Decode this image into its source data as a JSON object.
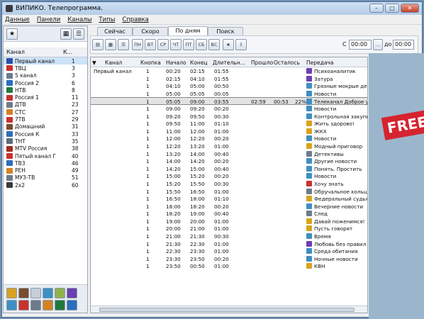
{
  "window": {
    "title": "ВИПИКО. Телепрограмма."
  },
  "menu": [
    "Данные",
    "Панели",
    "Каналы",
    "Типы",
    "Справка"
  ],
  "channels": {
    "header": [
      "Канал",
      "К..."
    ],
    "rows": [
      {
        "name": "Первый канал",
        "num": "1",
        "color": "#2a4fa8",
        "selected": true
      },
      {
        "name": "ТВЦ",
        "num": "3",
        "color": "#c8322e"
      },
      {
        "name": "5 канал",
        "num": "3",
        "color": "#6b7c8e"
      },
      {
        "name": "Россия 2",
        "num": "6",
        "color": "#2b6dbb"
      },
      {
        "name": "НТВ",
        "num": "8",
        "color": "#1f7a3a"
      },
      {
        "name": "Россия 1",
        "num": "11",
        "color": "#c8322e"
      },
      {
        "name": "ДТВ",
        "num": "23",
        "color": "#6d7b8a"
      },
      {
        "name": "СТС",
        "num": "27",
        "color": "#d28322"
      },
      {
        "name": "7ТВ",
        "num": "29",
        "color": "#c8322e"
      },
      {
        "name": "Домашний",
        "num": "31",
        "color": "#7a4d2a"
      },
      {
        "name": "Россия К",
        "num": "33",
        "color": "#2b6dbb"
      },
      {
        "name": "ТНТ",
        "num": "35",
        "color": "#5a6b7d"
      },
      {
        "name": "MTV Россия",
        "num": "38",
        "color": "#a02a1e"
      },
      {
        "name": "Пятый канал Г",
        "num": "40",
        "color": "#c8322e"
      },
      {
        "name": "ТВ3",
        "num": "46",
        "color": "#2b6dbb"
      },
      {
        "name": "РЕН",
        "num": "49",
        "color": "#d28322"
      },
      {
        "name": "МУЗ-ТВ",
        "num": "51",
        "color": "#6d7b8a"
      },
      {
        "name": "2x2",
        "num": "60",
        "color": "#3a3a3a"
      }
    ]
  },
  "tabs": [
    "Сейчас",
    "Скоро",
    "По дням",
    "Поиск"
  ],
  "toolbar": {
    "days": [
      "ПН",
      "ВТ",
      "СР",
      "ЧТ",
      "ПТ",
      "СБ",
      "ВС"
    ],
    "from_label": "С",
    "from_value": "00:00",
    "to_label": "до",
    "to_value": "00:00",
    "more_label": "..."
  },
  "grid": {
    "columns": [
      "Канал",
      "Кнопка",
      "Начало",
      "Конец",
      "Длительн...",
      "Прошло",
      "Осталось",
      "Передача"
    ],
    "channel_label": "Первый канал",
    "rows": [
      {
        "btn": "1",
        "start": "00:20",
        "end": "02:15",
        "dur": "01:55",
        "passed": "",
        "left": "",
        "pct": "",
        "title": "Психоаналитик",
        "color": "#6c3fb0"
      },
      {
        "btn": "1",
        "start": "02:15",
        "end": "04:10",
        "dur": "01:55",
        "passed": "",
        "left": "",
        "pct": "",
        "title": "Затура",
        "color": "#6c3fb0"
      },
      {
        "btn": "1",
        "start": "04:10",
        "end": "05:00",
        "dur": "00:50",
        "passed": "",
        "left": "",
        "pct": "",
        "title": "Грязные мокрые день",
        "color": "#3f8fc4"
      },
      {
        "btn": "1",
        "start": "05:00",
        "end": "05:05",
        "dur": "00:05",
        "passed": "",
        "left": "",
        "pct": "",
        "title": "Новости",
        "color": "#3f8fc4"
      },
      {
        "btn": "1",
        "start": "05:05",
        "end": "09:00",
        "dur": "03:55",
        "passed": "02:59",
        "left": "00:53",
        "pct": "22%",
        "title": "Телеканал Доброе ут",
        "color": "#3f8fc4",
        "selected": true
      },
      {
        "btn": "1",
        "start": "09:00",
        "end": "09:20",
        "dur": "00:20",
        "passed": "",
        "left": "",
        "pct": "",
        "title": "Новости",
        "color": "#3f8fc4"
      },
      {
        "btn": "1",
        "start": "09:20",
        "end": "09:50",
        "dur": "00:30",
        "passed": "",
        "left": "",
        "pct": "",
        "title": "Контрольная закупка",
        "color": "#3f8fc4"
      },
      {
        "btn": "1",
        "start": "09:50",
        "end": "11:00",
        "dur": "01:10",
        "passed": "",
        "left": "",
        "pct": "",
        "title": "Жить здорово!",
        "color": "#d9a21f"
      },
      {
        "btn": "1",
        "start": "11:00",
        "end": "12:00",
        "dur": "01:00",
        "passed": "",
        "left": "",
        "pct": "",
        "title": "ЖКХ",
        "color": "#d9a21f"
      },
      {
        "btn": "1",
        "start": "12:00",
        "end": "12:20",
        "dur": "00:20",
        "passed": "",
        "left": "",
        "pct": "",
        "title": "Новости",
        "color": "#3f8fc4"
      },
      {
        "btn": "1",
        "start": "12:20",
        "end": "13:20",
        "dur": "01:00",
        "passed": "",
        "left": "",
        "pct": "",
        "title": "Модный приговор",
        "color": "#d9a21f"
      },
      {
        "btn": "1",
        "start": "13:20",
        "end": "14:00",
        "dur": "00:40",
        "passed": "",
        "left": "",
        "pct": "",
        "title": "Детективы",
        "color": "#6d7b8a"
      },
      {
        "btn": "1",
        "start": "14:00",
        "end": "14:20",
        "dur": "00:20",
        "passed": "",
        "left": "",
        "pct": "",
        "title": "Другие новости",
        "color": "#3f8fc4"
      },
      {
        "btn": "1",
        "start": "14:20",
        "end": "15:00",
        "dur": "00:40",
        "passed": "",
        "left": "",
        "pct": "",
        "title": "Понять. Простить",
        "color": "#3f8fc4"
      },
      {
        "btn": "1",
        "start": "15:00",
        "end": "15:20",
        "dur": "00:20",
        "passed": "",
        "left": "",
        "pct": "",
        "title": "Новости",
        "color": "#3f8fc4"
      },
      {
        "btn": "1",
        "start": "15:20",
        "end": "15:50",
        "dur": "00:30",
        "passed": "",
        "left": "",
        "pct": "",
        "title": "Хочу знать",
        "color": "#c8322e"
      },
      {
        "btn": "1",
        "start": "15:50",
        "end": "16:50",
        "dur": "01:00",
        "passed": "",
        "left": "",
        "pct": "",
        "title": "Обручальное кольцо",
        "color": "#6d7b8a"
      },
      {
        "btn": "1",
        "start": "16:50",
        "end": "18:00",
        "dur": "01:10",
        "passed": "",
        "left": "",
        "pct": "",
        "title": "Федеральный судья",
        "color": "#d9a21f"
      },
      {
        "btn": "1",
        "start": "18:00",
        "end": "18:20",
        "dur": "00:20",
        "passed": "",
        "left": "",
        "pct": "",
        "title": "Вечерние новости",
        "color": "#3f8fc4"
      },
      {
        "btn": "1",
        "start": "18:20",
        "end": "19:00",
        "dur": "00:40",
        "passed": "",
        "left": "",
        "pct": "",
        "title": "След",
        "color": "#6d7b8a"
      },
      {
        "btn": "1",
        "start": "19:00",
        "end": "20:00",
        "dur": "01:00",
        "passed": "",
        "left": "",
        "pct": "",
        "title": "Давай поженимся!",
        "color": "#d9a21f"
      },
      {
        "btn": "1",
        "start": "20:00",
        "end": "21:00",
        "dur": "01:00",
        "passed": "",
        "left": "",
        "pct": "",
        "title": "Пусть говорят",
        "color": "#d9a21f"
      },
      {
        "btn": "1",
        "start": "21:00",
        "end": "21:30",
        "dur": "00:30",
        "passed": "",
        "left": "",
        "pct": "",
        "title": "Время",
        "color": "#3f8fc4"
      },
      {
        "btn": "1",
        "start": "21:30",
        "end": "22:30",
        "dur": "01:00",
        "passed": "",
        "left": "",
        "pct": "",
        "title": "Любовь без правил",
        "color": "#6c3fb0"
      },
      {
        "btn": "1",
        "start": "22:30",
        "end": "23:30",
        "dur": "01:00",
        "passed": "",
        "left": "",
        "pct": "",
        "title": "Среда обитания",
        "color": "#3f8fc4"
      },
      {
        "btn": "1",
        "start": "23:30",
        "end": "23:50",
        "dur": "00:20",
        "passed": "",
        "left": "",
        "pct": "",
        "title": "Ночные новости",
        "color": "#3f8fc4"
      },
      {
        "btn": "1",
        "start": "23:50",
        "end": "00:50",
        "dur": "01:00",
        "passed": "",
        "left": "",
        "pct": "",
        "title": "КВН",
        "color": "#d9a21f"
      }
    ]
  },
  "overlay": {
    "badge": "FREE"
  }
}
